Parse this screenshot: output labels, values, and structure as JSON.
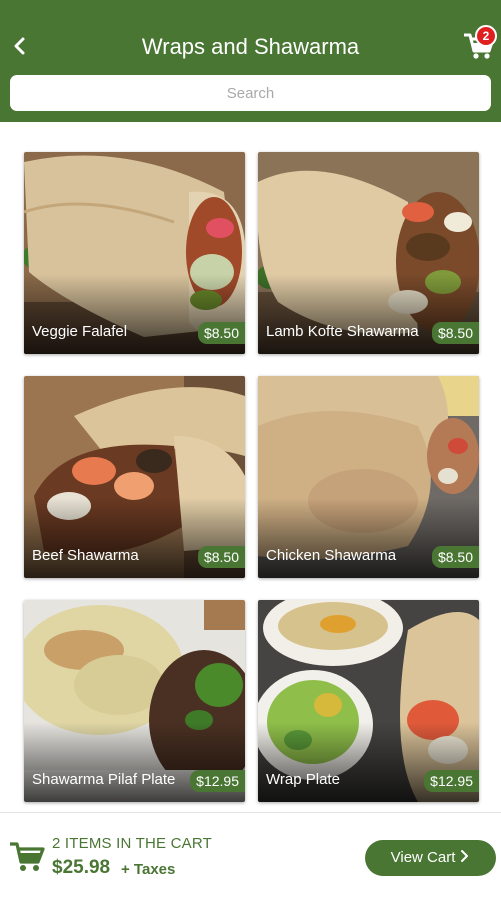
{
  "header": {
    "back_icon": "chevron-left-icon",
    "title": "Wraps and Shawarma",
    "cart_icon": "cart-icon",
    "cart_badge": "2",
    "search_placeholder": "Search"
  },
  "items": [
    {
      "name": "Veggie Falafel",
      "price": "$8.50"
    },
    {
      "name": "Lamb Kofte Shawarma",
      "price": "$8.50"
    },
    {
      "name": "Beef Shawarma",
      "price": "$8.50"
    },
    {
      "name": "Chicken Shawarma",
      "price": "$8.50"
    },
    {
      "name": "Shawarma Pilaf Plate",
      "price": "$12.95"
    },
    {
      "name": "Wrap Plate",
      "price": "$12.95"
    }
  ],
  "footer": {
    "cart_icon": "cart-icon",
    "items_text": "2 ITEMS IN THE CART",
    "total": "$25.98",
    "taxes": "+ Taxes",
    "view_cart": "View Cart",
    "view_cart_icon": "chevron-right-icon"
  },
  "colors": {
    "brand_green": "#4a7634",
    "badge_red": "#e02020"
  }
}
